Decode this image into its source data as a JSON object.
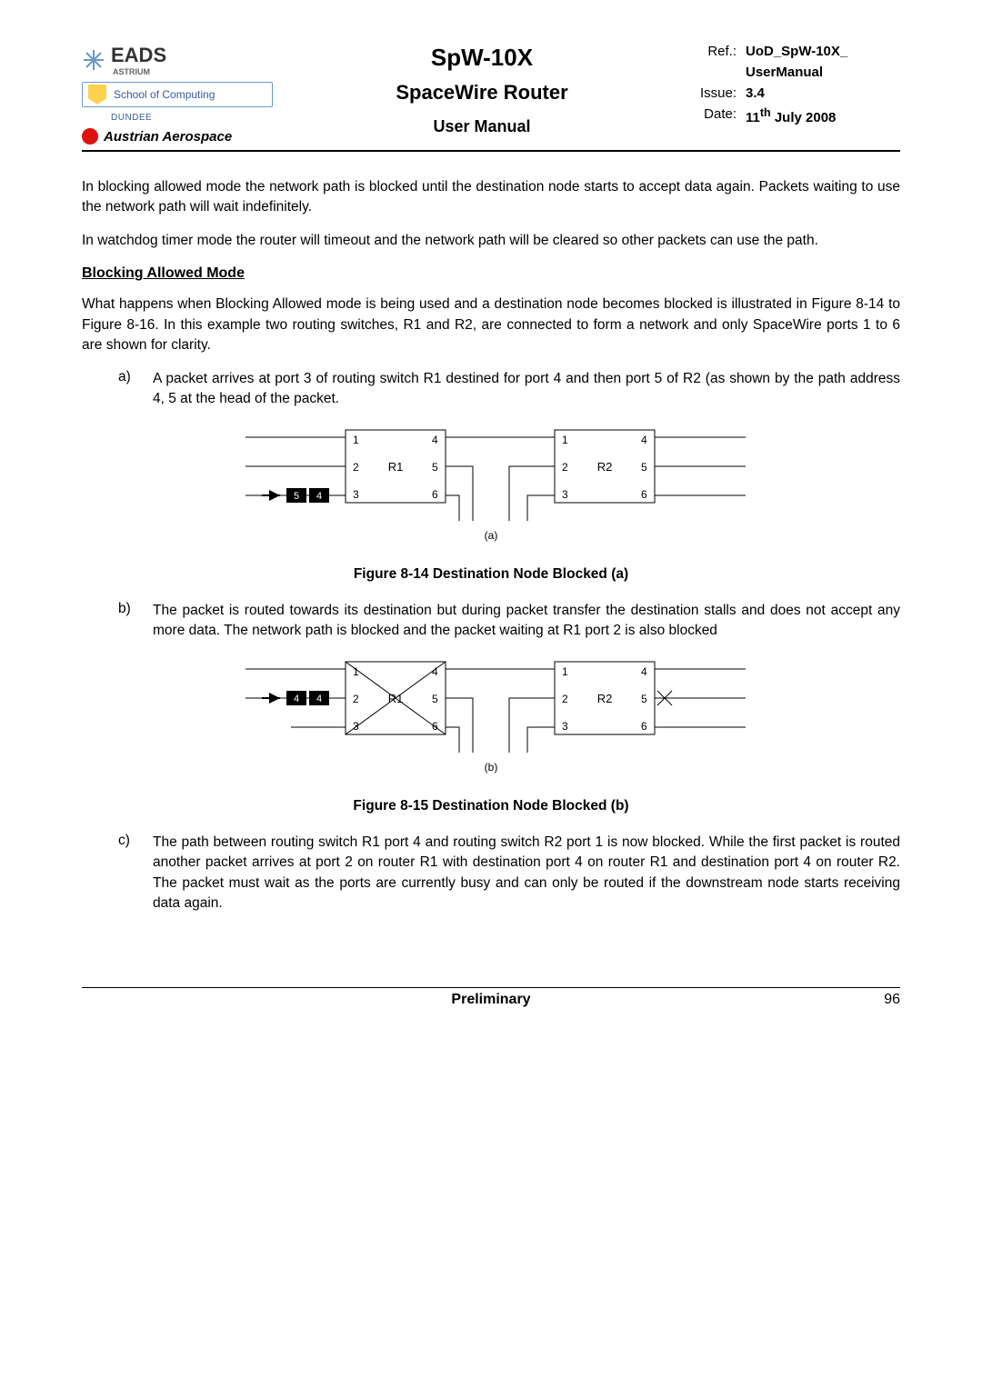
{
  "header": {
    "logo_text": "EADS",
    "logo_sub": "ASTRIUM",
    "school": "School of Computing",
    "dundee": "DUNDEE",
    "austrian": "Austrian Aerospace",
    "title1": "SpW-10X",
    "title2": "SpaceWire Router",
    "title3": "User Manual",
    "ref_label": "Ref.:",
    "ref_val": "UoD_SpW-10X_",
    "ref_val2": "UserManual",
    "issue_label": "Issue:",
    "issue_val": "3.4",
    "date_label": "Date:",
    "date_val": "11th July 2008",
    "date_val_pre": "11",
    "date_val_sup": "th",
    "date_val_post": " July 2008"
  },
  "body": {
    "p1": "In blocking allowed mode the network path is blocked until the destination node starts to accept data again. Packets waiting to use the network path will wait indefinitely.",
    "p2": "In watchdog timer mode the router will timeout and the network path will be cleared so other packets can use the path.",
    "h1": "Blocking Allowed Mode",
    "p3": "What happens when Blocking Allowed mode is being used and a destination node becomes blocked is illustrated in Figure 8-14 to Figure 8-16.  In this example two routing switches, R1 and R2, are connected to form a network and only SpaceWire ports 1 to 6 are shown for clarity.",
    "li_a_letter": "a)",
    "li_a": "A packet arrives at port 3 of routing switch R1 destined for port 4 and then port 5 of R2 (as shown by the path address 4, 5 at the head of the packet.",
    "cap1": "Figure 8-14 Destination Node Blocked (a)",
    "li_b_letter": "b)",
    "li_b": "The packet is routed towards its destination but during packet transfer the destination stalls and does not accept any more data. The network path is blocked and the packet waiting at R1 port 2 is also blocked",
    "cap2": "Figure 8-15 Destination Node Blocked (b)",
    "li_c_letter": "c)",
    "li_c": "The path between routing switch R1 port 4 and routing switch R2 port 1 is now blocked. While the first packet is routed another packet arrives at port 2 on router R1 with destination port 4 on router R1 and destination port 4 on router R2. The packet must wait as the ports are currently busy and can only be routed if the downstream node starts receiving data again."
  },
  "diagram_a": {
    "r1": "R1",
    "r2": "R2",
    "p1": "1",
    "p2": "2",
    "p3": "3",
    "p4": "4",
    "p5": "5",
    "p6": "6",
    "pk1": "5",
    "pk2": "4",
    "tag": "(a)"
  },
  "diagram_b": {
    "r1": "R1",
    "r2": "R2",
    "p1": "1",
    "p2": "2",
    "p3": "3",
    "p4": "4",
    "p5": "5",
    "p6": "6",
    "pk1": "4",
    "pk2": "4",
    "tag": "(b)"
  },
  "footer": {
    "center": "Preliminary",
    "page": "96"
  }
}
